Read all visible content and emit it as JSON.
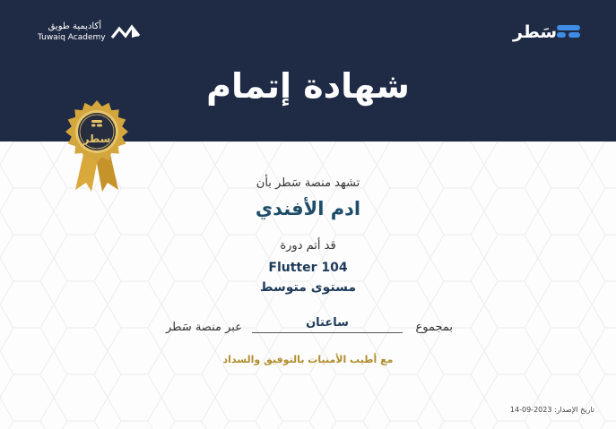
{
  "header": {
    "tuwaiq": {
      "name_ar": "أكاديمية طويق",
      "name_en": "Tuwaiq Academy",
      "icon": "tuwaiq-logo-icon"
    },
    "satr": {
      "name_ar": "سَطر",
      "icon": "satr-logo-icon"
    },
    "title": "شهادة إتمام"
  },
  "badge": {
    "label": "سطر",
    "icon": "award-seal-icon"
  },
  "certificate": {
    "intro": "تشهد منصة سَطر بأن",
    "recipient": "ادم الأفندي",
    "completed_label": "قد أتم دورة",
    "course": "Flutter 104",
    "level": "مستوى متوسط",
    "hours_prefix": "بمجموع",
    "hours_value": "ساعتان",
    "hours_suffix": "عبر منصة سَطر",
    "wishes": "مع أطيب الأمنيات بالتوفيق والسداد"
  },
  "issue_date": "تاريخ الإصدار: 2023-09-14"
}
